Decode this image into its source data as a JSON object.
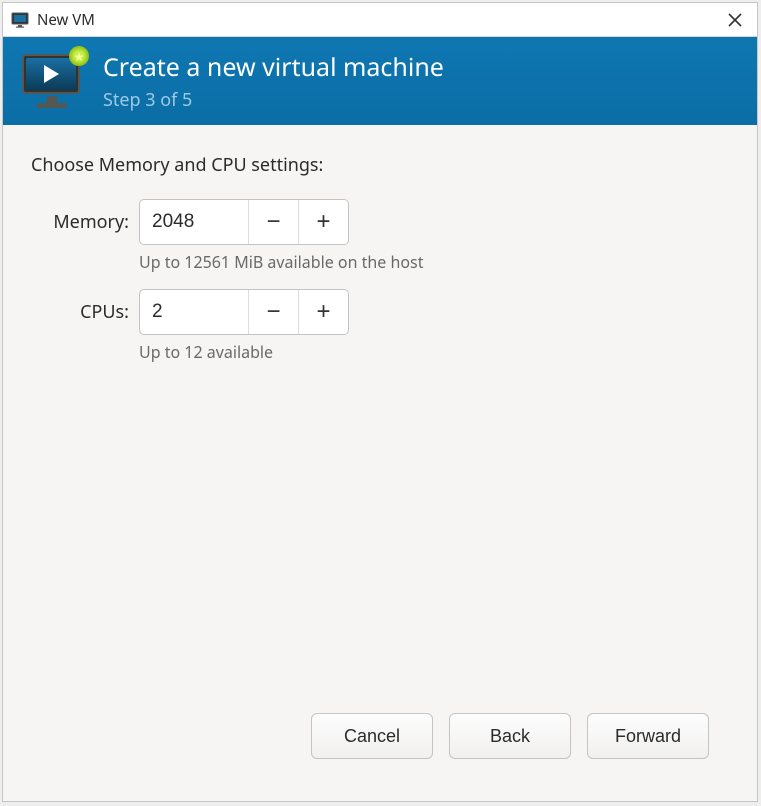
{
  "window": {
    "title": "New VM"
  },
  "banner": {
    "title": "Create a new virtual machine",
    "subtitle": "Step 3 of 5"
  },
  "section": {
    "heading": "Choose Memory and CPU settings:"
  },
  "memory": {
    "label": "Memory:",
    "value": "2048",
    "hint": "Up to 12561 MiB available on the host"
  },
  "cpus": {
    "label": "CPUs:",
    "value": "2",
    "hint": "Up to 12 available"
  },
  "buttons": {
    "cancel": "Cancel",
    "back": "Back",
    "forward": "Forward"
  },
  "glyphs": {
    "minus": "−",
    "plus": "+"
  }
}
